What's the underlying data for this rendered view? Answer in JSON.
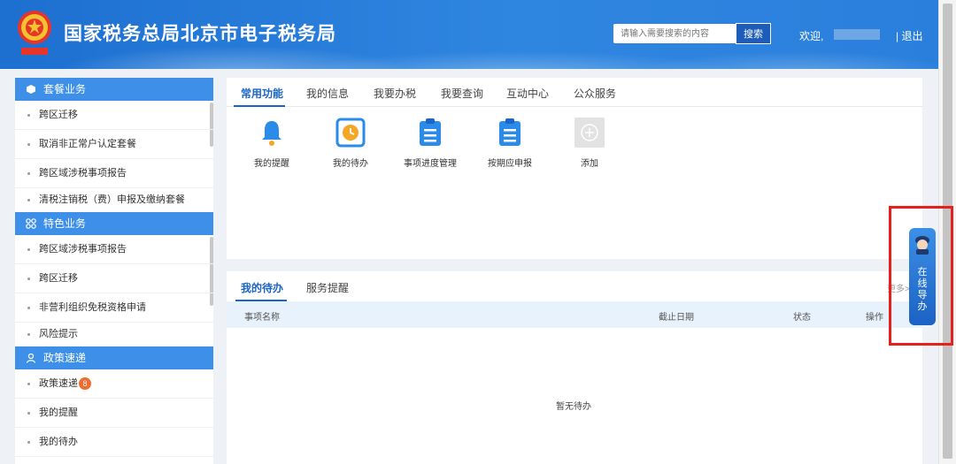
{
  "header": {
    "title": "国家税务总局北京市电子税务局",
    "search_placeholder": "请输入需要搜索的内容",
    "search_button": "搜索",
    "welcome": "欢迎,",
    "logout": "| 退出"
  },
  "sidebar": {
    "sections": [
      {
        "title": "套餐业务",
        "icon": "cube-icon",
        "items": [
          "跨区迁移",
          "取消非正常户认定套餐",
          "跨区域涉税事项报告",
          "清税注销税（费）申报及缴纳套餐"
        ]
      },
      {
        "title": "特色业务",
        "icon": "grid-icon",
        "items": [
          "跨区域涉税事项报告",
          "跨区迁移",
          "非营利组织免税资格申请",
          "风险提示"
        ]
      },
      {
        "title": "政策速递",
        "icon": "person-icon",
        "items": [
          "政策速递",
          "我的提醒",
          "我的待办"
        ],
        "badge": "8"
      }
    ]
  },
  "top_panel": {
    "tabs": [
      "常用功能",
      "我的信息",
      "我要办税",
      "我要查询",
      "互动中心",
      "公众服务"
    ],
    "functions": [
      {
        "label": "我的提醒",
        "icon": "bell-icon"
      },
      {
        "label": "我的待办",
        "icon": "clock-icon"
      },
      {
        "label": "事项进度管理",
        "icon": "clipboard-icon"
      },
      {
        "label": "按期应申报",
        "icon": "clipboard-icon"
      },
      {
        "label": "添加",
        "icon": "plus-icon"
      }
    ]
  },
  "bottom_panel": {
    "tabs": [
      "我的待办",
      "服务提醒"
    ],
    "more": "更多>",
    "columns": [
      "事项名称",
      "截止日期",
      "状态",
      "操作"
    ],
    "empty_text": "暂无待办"
  },
  "guide": {
    "chars": [
      "在",
      "线",
      "导",
      "办"
    ]
  },
  "colors": {
    "primary": "#1c64c6",
    "header": "#2a7fdc",
    "section": "#3d8fe8",
    "badge": "#f26a2e",
    "highlight": "#e8201d"
  }
}
